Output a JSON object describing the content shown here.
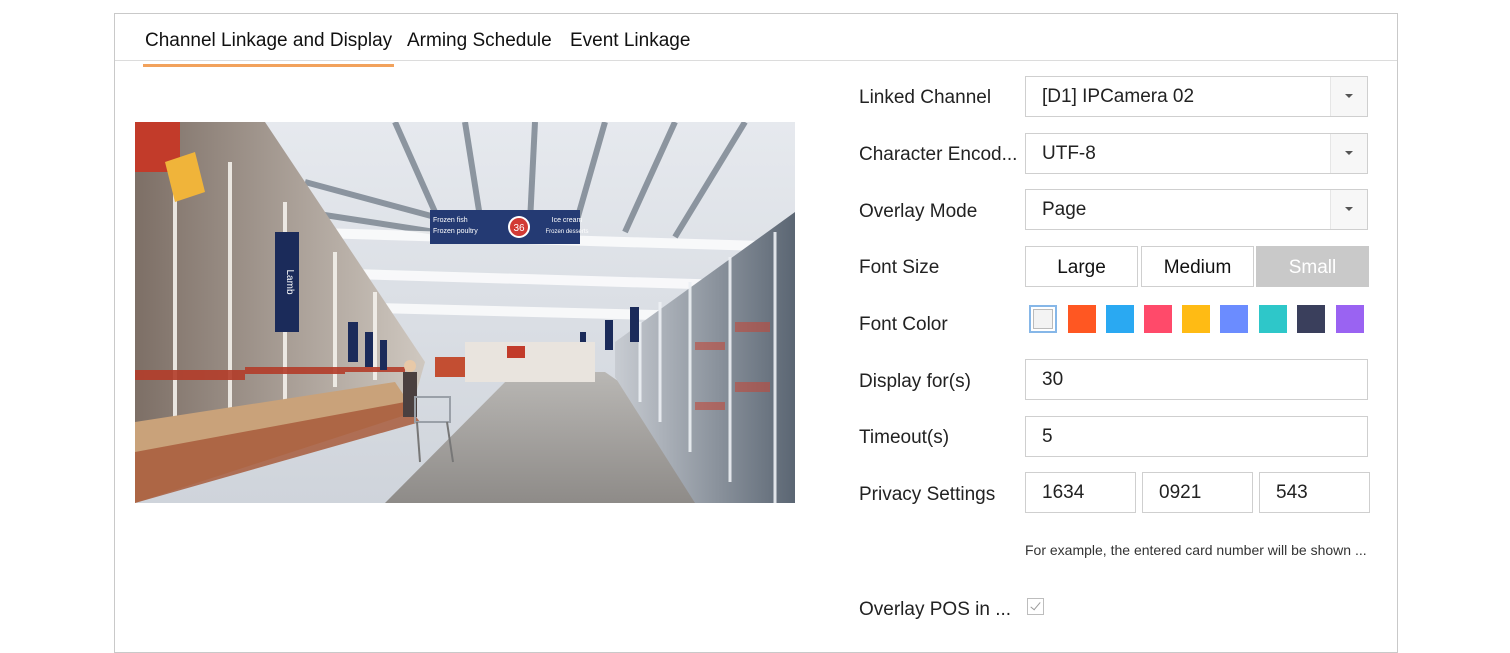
{
  "tabs": [
    {
      "label": "Channel Linkage and Display",
      "active": true
    },
    {
      "label": "Arming Schedule",
      "active": false
    },
    {
      "label": "Event Linkage",
      "active": false
    }
  ],
  "preview": {
    "sign_left_1": "Frozen fish",
    "sign_left_2": "Frozen poultry",
    "sign_number": "36",
    "sign_right_1": "Ice cream",
    "sign_right_2": "Frozen desserts",
    "side_sign": "Lamb"
  },
  "form": {
    "linked_channel": {
      "label": "Linked Channel",
      "value": "[D1] IPCamera 02"
    },
    "character_encoding": {
      "label": "Character Encod...",
      "value": "UTF-8"
    },
    "overlay_mode": {
      "label": "Overlay Mode",
      "value": "Page"
    },
    "font_size": {
      "label": "Font Size",
      "options": [
        "Large",
        "Medium",
        "Small"
      ],
      "selected": "Small"
    },
    "font_color": {
      "label": "Font Color",
      "colors": [
        "#f3f3f3",
        "#ff5722",
        "#2aa9f2",
        "#ff4a6a",
        "#ffbb14",
        "#6b8cff",
        "#2ec7c9",
        "#3a3f5c",
        "#9a63f2"
      ],
      "selected_index": 0
    },
    "display_for": {
      "label": "Display for(s)",
      "value": "30"
    },
    "timeout": {
      "label": "Timeout(s)",
      "value": "5"
    },
    "privacy_settings": {
      "label": "Privacy Settings",
      "values": [
        "1634",
        "0921",
        "543"
      ]
    },
    "privacy_hint": "For example, the entered card number will be shown ...",
    "overlay_pos": {
      "label": "Overlay POS in ...",
      "checked": true
    }
  }
}
